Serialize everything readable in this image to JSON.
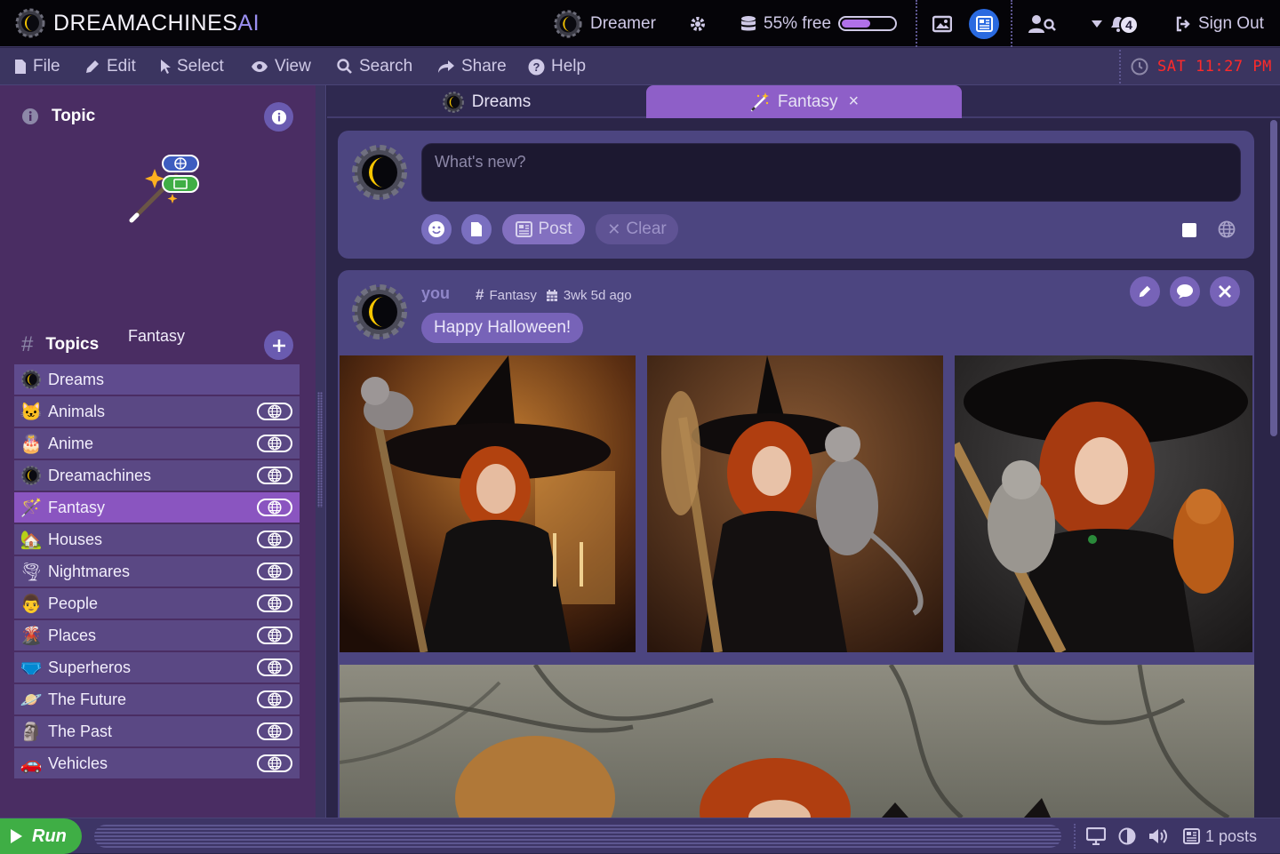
{
  "app": {
    "brand_main": "DREAMACHINES",
    "brand_ai": "AI"
  },
  "topbar": {
    "dreamer_label": "Dreamer",
    "storage_text": "55% free",
    "storage_fraction": 0.55,
    "notification_count": "4",
    "signout_label": "Sign Out"
  },
  "menu": {
    "file": "File",
    "edit": "Edit",
    "select": "Select",
    "view": "View",
    "search": "Search",
    "share": "Share",
    "help": "Help"
  },
  "clock": {
    "text": "SAT 11:27 PM",
    "color": "#ff2a2a"
  },
  "sidebar": {
    "topic_heading": "Topic",
    "current_topic": "Fantasy",
    "topics_heading": "Topics",
    "topics": [
      {
        "label": "Dreams",
        "icon": "dreams-moon-icon",
        "globe": false
      },
      {
        "label": "Animals",
        "icon": "cat-icon",
        "globe": true
      },
      {
        "label": "Anime",
        "icon": "anime-icon",
        "globe": true
      },
      {
        "label": "Dreamachines",
        "icon": "dreams-moon-icon",
        "globe": true
      },
      {
        "label": "Fantasy",
        "icon": "magic-wand-icon",
        "globe": true,
        "active": true
      },
      {
        "label": "Houses",
        "icon": "house-icon",
        "globe": true
      },
      {
        "label": "Nightmares",
        "icon": "tornado-icon",
        "globe": true
      },
      {
        "label": "People",
        "icon": "person-icon",
        "globe": true
      },
      {
        "label": "Places",
        "icon": "volcano-icon",
        "globe": true
      },
      {
        "label": "Superheros",
        "icon": "briefs-icon",
        "globe": true
      },
      {
        "label": "The Future",
        "icon": "planet-icon",
        "globe": true
      },
      {
        "label": "The Past",
        "icon": "moai-icon",
        "globe": true
      },
      {
        "label": "Vehicles",
        "icon": "car-icon",
        "globe": true
      }
    ]
  },
  "tabs": [
    {
      "label": "Dreams",
      "icon": "dreams-moon-icon"
    },
    {
      "label": "Fantasy",
      "icon": "magic-wand-icon",
      "close": "×",
      "active": true
    }
  ],
  "composer": {
    "placeholder": "What's new?",
    "post_label": "Post",
    "clear_label": "Clear"
  },
  "post": {
    "user": "you",
    "topic": "Fantasy",
    "time": "3wk 5d ago",
    "text": "Happy Halloween!"
  },
  "status": {
    "run_label": "Run",
    "posts_count": "1 posts"
  },
  "colors": {
    "accent": "#8e5fc8",
    "run": "#3fae45",
    "brand_ai": "#9a8ff0"
  }
}
